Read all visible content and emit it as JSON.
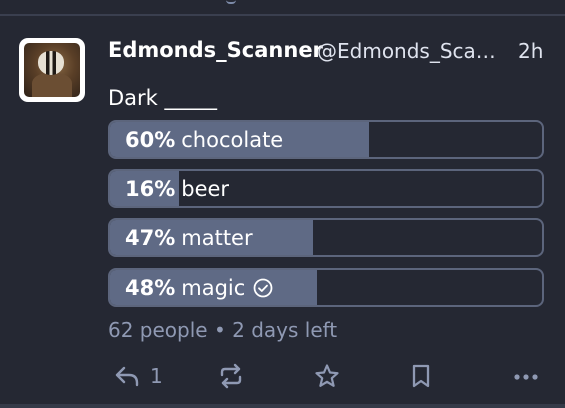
{
  "post": {
    "display_name": "Edmonds_Scanner",
    "handle": "@Edmonds_Sca…",
    "time": "2h",
    "text": "Dark _____"
  },
  "poll": {
    "options": [
      {
        "percent_label": "60%",
        "label": "chocolate",
        "percent": 60,
        "voted": false
      },
      {
        "percent_label": "16%",
        "label": "beer",
        "percent": 16,
        "voted": false
      },
      {
        "percent_label": "47%",
        "label": "matter",
        "percent": 47,
        "voted": false
      },
      {
        "percent_label": "48%",
        "label": "magic",
        "percent": 48,
        "voted": true
      }
    ],
    "meta": "62 people • 2 days left"
  },
  "actions": {
    "reply_count": "1",
    "icons": [
      "reply-icon",
      "boost-icon",
      "favourite-icon",
      "bookmark-icon",
      "more-icon"
    ]
  },
  "colors": {
    "background": "#252833",
    "poll_fill": "#5f6a85",
    "poll_border": "#5c657c",
    "muted_text": "#8f99b3"
  }
}
